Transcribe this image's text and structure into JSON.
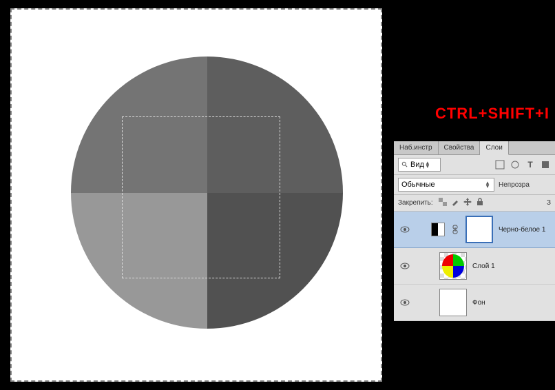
{
  "label": "CTRL+SHIFT+I",
  "tabs": {
    "navigator": "Наб.инстр",
    "properties": "Свойства",
    "layers": "Слои"
  },
  "toolbar": {
    "search": "Вид"
  },
  "blend": {
    "mode": "Обычные",
    "opacity_label": "Непрозра"
  },
  "lock": {
    "label": "Закрепить:",
    "fill_label": "З"
  },
  "layers": {
    "adj": "Черно-белое 1",
    "layer1": "Слой 1",
    "bg": "Фон"
  }
}
